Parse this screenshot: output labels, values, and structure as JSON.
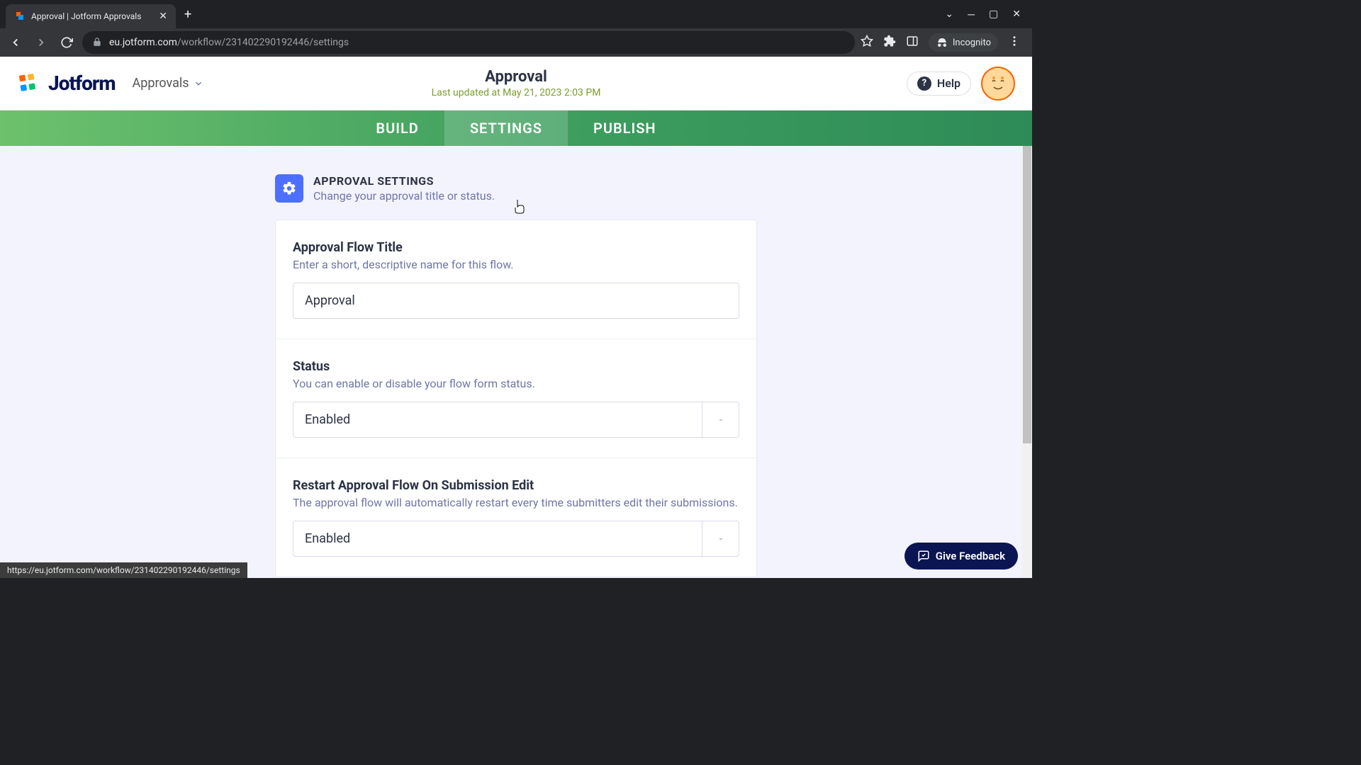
{
  "browser": {
    "tab_title": "Approval | Jotform Approvals",
    "url_host": "eu.jotform.com",
    "url_path": "/workflow/231402290192446/settings",
    "incognito_label": "Incognito",
    "status_url": "https://eu.jotform.com/workflow/231402290192446/settings"
  },
  "header": {
    "logo_text": "Jotform",
    "dropdown": "Approvals",
    "title": "Approval",
    "last_updated": "Last updated at May 21, 2023 2:03 PM",
    "help": "Help"
  },
  "tabs": {
    "build": "BUILD",
    "settings": "SETTINGS",
    "publish": "PUBLISH"
  },
  "section": {
    "title": "APPROVAL SETTINGS",
    "subtitle": "Change your approval title or status."
  },
  "settings": {
    "flow_title": {
      "label": "Approval Flow Title",
      "desc": "Enter a short, descriptive name for this flow.",
      "value": "Approval"
    },
    "status": {
      "label": "Status",
      "desc": "You can enable or disable your flow form status.",
      "value": "Enabled"
    },
    "restart": {
      "label": "Restart Approval Flow On Submission Edit",
      "desc": "The approval flow will automatically restart every time submitters edit their submissions.",
      "value": "Enabled"
    }
  },
  "feedback": "Give Feedback"
}
